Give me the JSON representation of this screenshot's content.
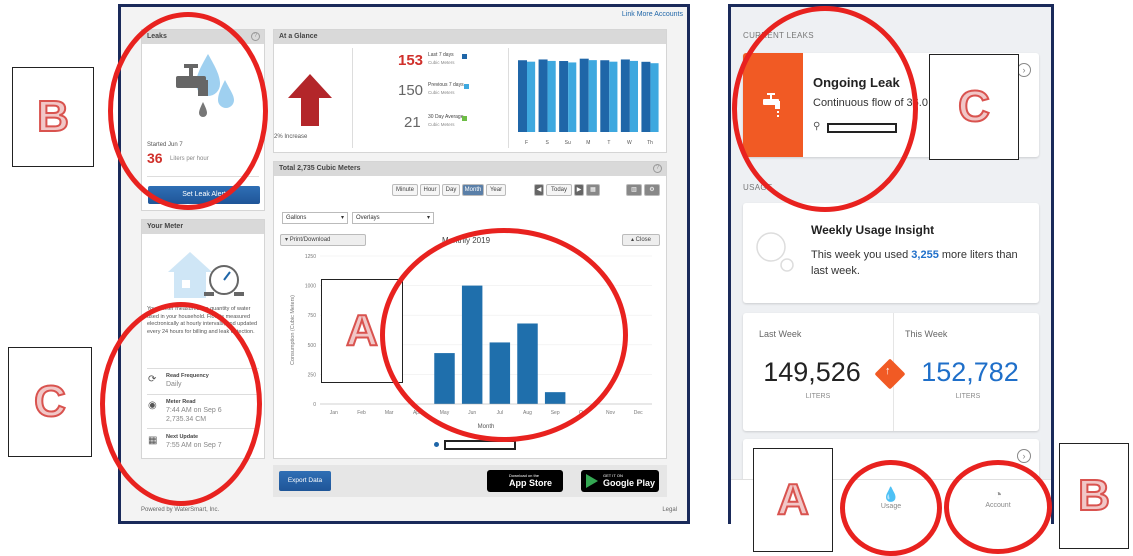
{
  "left": {
    "link_more": "Link More Accounts",
    "leaks_panel": {
      "title": "Leaks",
      "started": "Started Jun 7",
      "rate_value": "36",
      "rate_unit": "Liters per hour",
      "button": "Set Leak Alert"
    },
    "meter_panel": {
      "title": "Your Meter",
      "description": "Your meter measures the quantity of water used in your household. Flow is measured electronically at hourly intervals, and updated every 24 hours for billing and leak detection.",
      "read_freq_label": "Read Frequency",
      "read_freq_value": "Daily",
      "meter_read_label": "Meter Read",
      "meter_read_time": "7:44 AM on Sep 6",
      "meter_read_value": "2,735.34 CM",
      "next_update_label": "Next Update",
      "next_update_value": "7:55 AM on Sep 7"
    },
    "glance": {
      "title": "At a Glance",
      "increase": "2% Increase",
      "last7_value": "153",
      "last7_label": "Last 7 days",
      "last7_unit": "Cubic Meters",
      "prev7_value": "150",
      "prev7_label": "Previous 7 days",
      "prev7_unit": "Cubic Meters",
      "avg_value": "21",
      "avg_label": "30 Day Average",
      "avg_unit": "Cubic Meters",
      "days": [
        "F",
        "S",
        "Su",
        "M",
        "T",
        "W",
        "Th"
      ]
    },
    "main": {
      "title": "Total 2,735 Cubic Meters",
      "periods": [
        "Minute",
        "Hour",
        "Day",
        "Month",
        "Year"
      ],
      "active_period": "Month",
      "today": "Today",
      "unit_select": "Gallons",
      "overlay_select": "Overlays",
      "print": "Print/Download",
      "close": "Close",
      "chart_title": "Monthly 2019",
      "export": "Export Data",
      "app_store_small": "Download on the",
      "app_store": "App Store",
      "google_small": "GET IT ON",
      "google": "Google Play"
    },
    "footer_left": "Powered by WaterSmart, Inc.",
    "footer_right": "Legal"
  },
  "chart_data": {
    "type": "bar",
    "title": "Monthly 2019",
    "xlabel": "Month",
    "ylabel": "Consumption (Cubic Meters)",
    "categories": [
      "Jan",
      "Feb",
      "Mar",
      "Apr",
      "May",
      "Jun",
      "Jul",
      "Aug",
      "Sep",
      "Oct",
      "Nov",
      "Dec"
    ],
    "values": [
      0,
      0,
      0,
      0,
      430,
      1000,
      520,
      680,
      100,
      0,
      0,
      0
    ],
    "ylim": [
      0,
      1250
    ],
    "yticks": [
      0,
      250,
      500,
      750,
      1000,
      1250
    ]
  },
  "glance_chart": {
    "values": [
      0.92,
      0.93,
      0.91,
      0.94,
      0.92,
      0.93,
      0.9
    ]
  },
  "right": {
    "current_leaks": "CURRENT LEAKS",
    "leak_title": "Ongoing Leak",
    "leak_text": "Continuous flow of 36.0 L/hr.",
    "usage": "USAGE",
    "insight_title": "Weekly Usage Insight",
    "insight_pre": "This week you used ",
    "insight_num": "3,255",
    "insight_post": " more liters than last week.",
    "last_week_label": "Last Week",
    "this_week_label": "This Week",
    "last_week_value": "149,526",
    "this_week_value": "152,782",
    "liters": "LITERS",
    "tab_usage": "Usage",
    "tab_account": "Account"
  },
  "annotations": {
    "a": "A",
    "b": "B",
    "c": "C"
  },
  "colors": {
    "accent_blue": "#1f66a8",
    "bar_blue": "#2576b8",
    "red": "#d0302b",
    "leak_orange": "#f15a24",
    "ring": "#e8221f"
  }
}
